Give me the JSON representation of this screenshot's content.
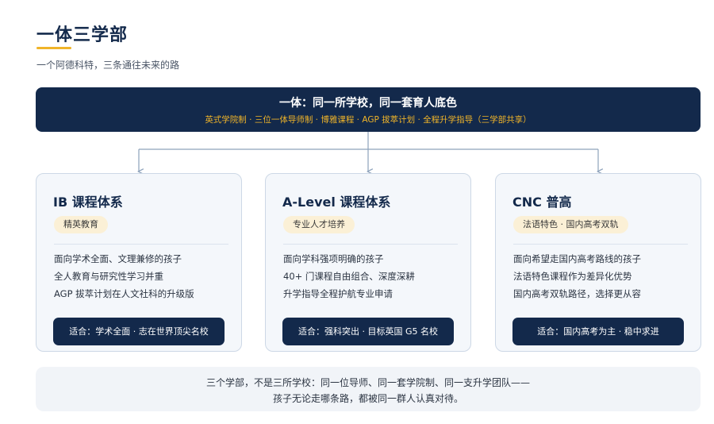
{
  "header": {
    "title": "一体三学部",
    "subtitle": "一个阿德科特，三条通往未来的路"
  },
  "banner": {
    "title": "一体：同一所学校，同一套育人底色",
    "subtitle": "英式学院制 · 三位一体导师制 · 博雅课程 · AGP 拔萃计划 · 全程升学指导（三学部共享）"
  },
  "cards": [
    {
      "title": "IB 课程体系",
      "tag": "精英教育",
      "points": [
        "面向学术全面、文理兼修的孩子",
        "全人教育与研究性学习并重",
        "AGP 拔萃计划在人文社科的升级版"
      ],
      "fit": "适合：学术全面 · 志在世界顶尖名校"
    },
    {
      "title": "A-Level 课程体系",
      "tag": "专业人才培养",
      "points": [
        "面向学科强项明确的孩子",
        "40+ 门课程自由组合、深度深耕",
        "升学指导全程护航专业申请"
      ],
      "fit": "适合：强科突出 · 目标英国 G5 名校"
    },
    {
      "title": "CNC 普高",
      "tag": "法语特色 · 国内高考双轨",
      "points": [
        "面向希望走国内高考路线的孩子",
        "法语特色课程作为差异化优势",
        "国内高考双轨路径，选择更从容"
      ],
      "fit": "适合：国内高考为主 · 稳中求进"
    }
  ],
  "footer": {
    "line1": "三个学部，不是三所学校：同一位导师、同一套学院制、同一支升学团队——",
    "line2": "孩子无论走哪条路，都被同一群人认真对待。"
  },
  "colors": {
    "navy": "#13294b",
    "accent": "#f0b429",
    "tag_bg": "#fbf0d6",
    "card_bg": "#f4f7fb",
    "connector": "#8da2bb"
  }
}
